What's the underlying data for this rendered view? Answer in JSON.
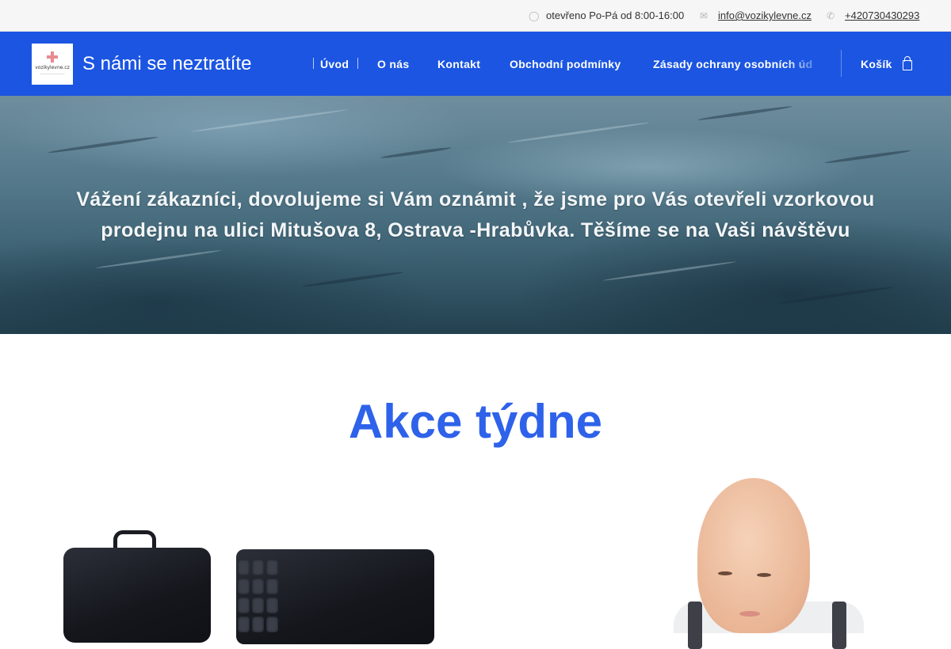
{
  "topbar": {
    "hours_icon": "clock-icon",
    "hours": "otevřeno Po-Pá od 8:00-16:00",
    "email_icon": "envelope-icon",
    "email": "info@vozikylevne.cz",
    "phone_icon": "phone-icon",
    "phone": "+420730430293"
  },
  "header": {
    "logo_text": "vozikylevne.cz",
    "site_title": "S námi se neztratíte",
    "nav": [
      "Úvod",
      "O nás",
      "Kontakt",
      "Obchodní podmínky",
      "Zásady ochrany osobních úd"
    ],
    "cart_label": "Košík",
    "cart_icon": "shopping-bag-icon"
  },
  "hero": {
    "text": "Vážení zákazníci, dovolujeme si Vám oznámit , že jsme pro Vás otevřeli vzorkovou prodejnu na ulici Mitušova 8, Ostrava -Hrabůvka. Těšíme se na Vaši návštěvu"
  },
  "section": {
    "title": "Akce týdne"
  },
  "colors": {
    "header_bg": "#1b55e2",
    "title_blue": "#2e62ea",
    "topbar_bg": "#f7f6f7"
  }
}
